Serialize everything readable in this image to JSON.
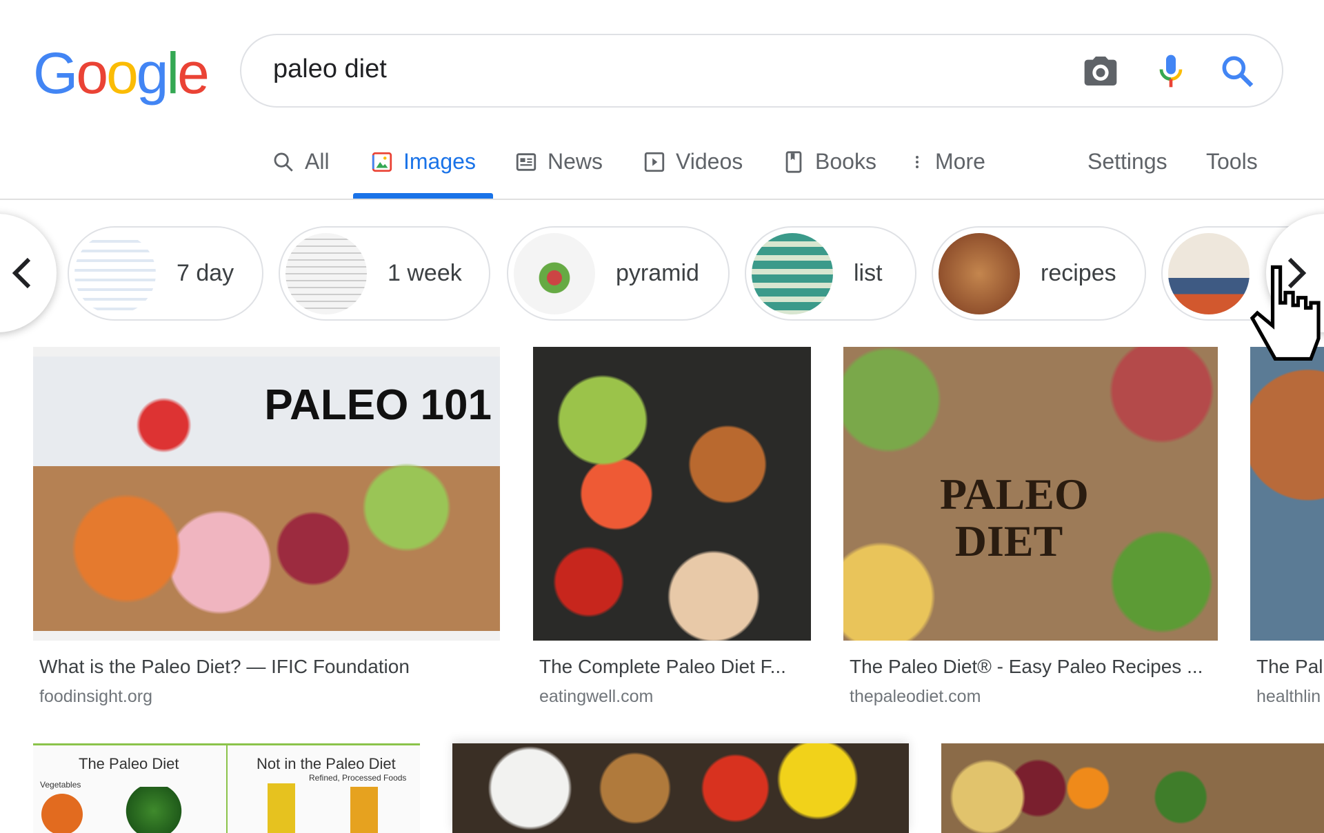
{
  "logo": "Google",
  "search": {
    "query": "paleo diet",
    "icons": [
      "camera-icon",
      "microphone-icon",
      "search-icon"
    ]
  },
  "tabs": [
    {
      "label": "All",
      "icon": "search-icon"
    },
    {
      "label": "Images",
      "icon": "image-icon",
      "active": true
    },
    {
      "label": "News",
      "icon": "news-icon"
    },
    {
      "label": "Videos",
      "icon": "play-icon"
    },
    {
      "label": "Books",
      "icon": "book-icon"
    },
    {
      "label": "More",
      "icon": "more-vert-icon"
    }
  ],
  "settings": "Settings",
  "tools": "Tools",
  "chips": [
    {
      "label": "7 day"
    },
    {
      "label": "1 week"
    },
    {
      "label": "pyramid"
    },
    {
      "label": "list"
    },
    {
      "label": "recipes"
    },
    {
      "label": ""
    }
  ],
  "results": [
    {
      "title": "What is the Paleo Diet? — IFIC Foundation",
      "source": "foodinsight.org",
      "image_text": "PALEO 101"
    },
    {
      "title": "The Complete Paleo Diet F...",
      "source": "eatingwell.com"
    },
    {
      "title": "The Paleo Diet® - Easy Paleo Recipes ...",
      "source": "thepaleodiet.com",
      "image_text": "PALEO DIET"
    },
    {
      "title": "The Pal",
      "source": "healthlin"
    }
  ],
  "row2": [
    {
      "image_text_left": "The Paleo Diet",
      "image_text_right": "Not in the Paleo Diet",
      "sub_left": "Vegetables",
      "sub_right": "Refined, Processed Foods"
    },
    {},
    {}
  ],
  "colors": {
    "accent": "#1a73e8",
    "blue": "#4285f4",
    "red": "#ea4335",
    "yellow": "#fbbc05",
    "green": "#34a853"
  }
}
